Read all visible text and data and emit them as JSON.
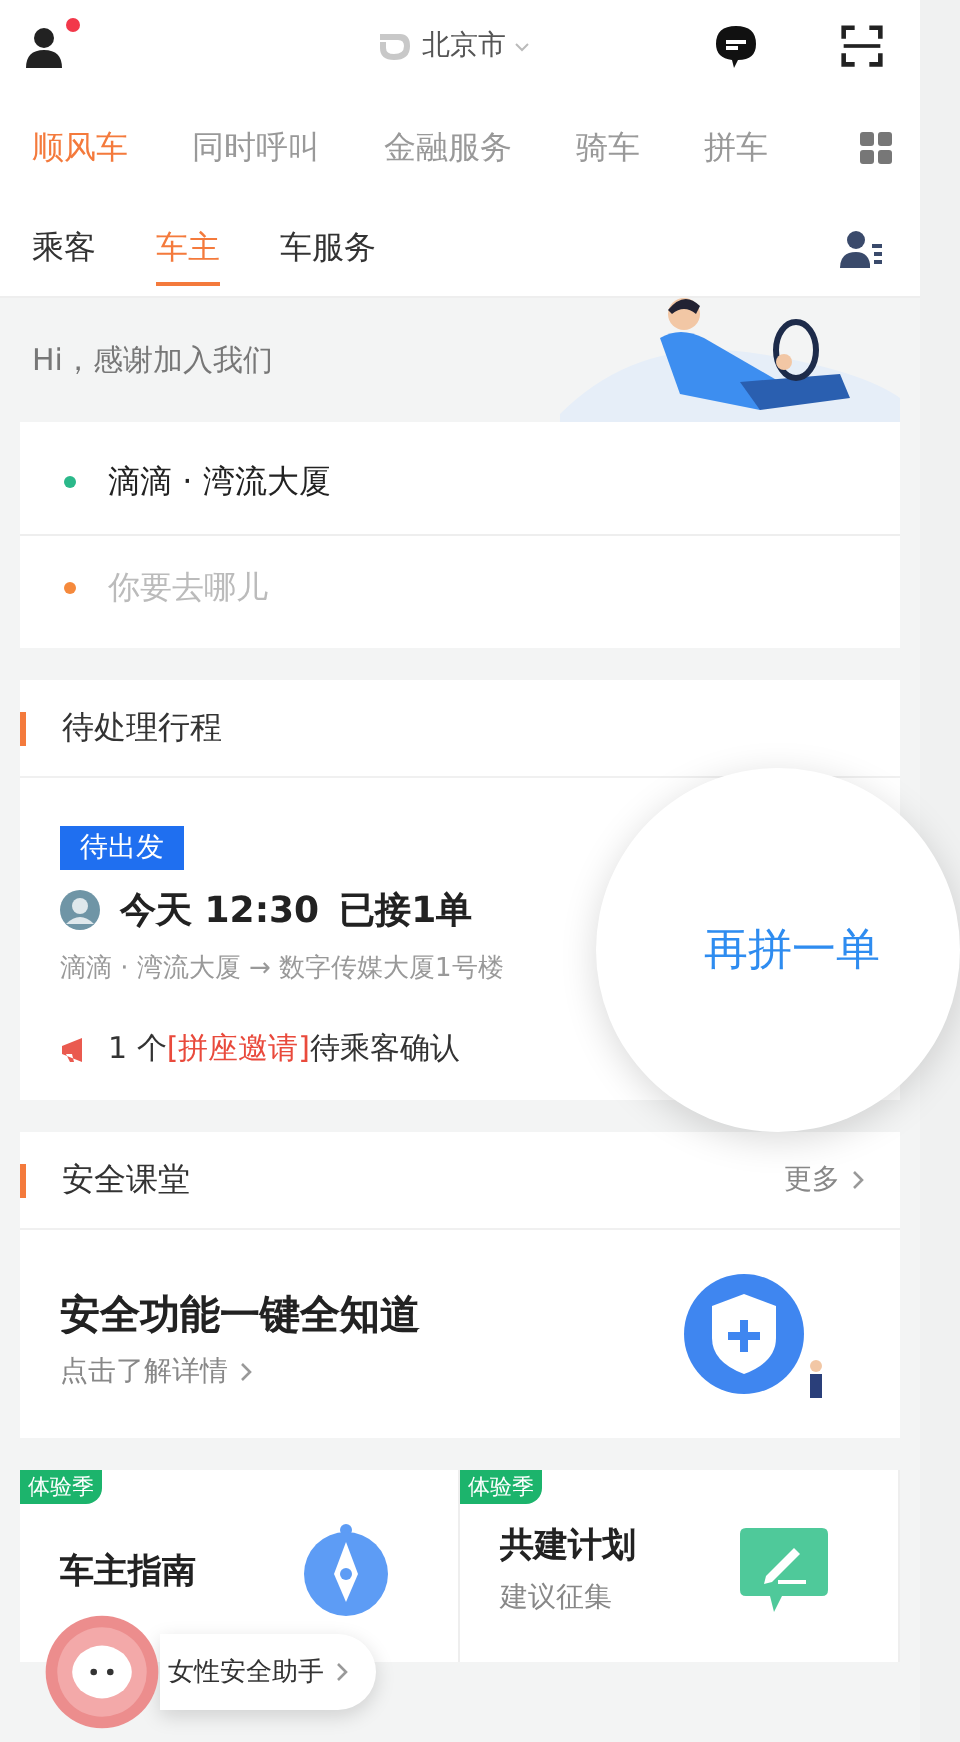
{
  "top_bar": {
    "city": "北京市",
    "has_notification": true
  },
  "services": [
    {
      "label": "顺风车",
      "selected": true
    },
    {
      "label": "同时呼叫",
      "selected": false
    },
    {
      "label": "金融服务",
      "selected": false
    },
    {
      "label": "骑车",
      "selected": false
    },
    {
      "label": "拼车",
      "selected": false
    }
  ],
  "roles": [
    {
      "label": "乘客",
      "selected": false
    },
    {
      "label": "车主",
      "selected": true
    },
    {
      "label": "车服务",
      "selected": false
    }
  ],
  "greeting": "Hi，感谢加入我们",
  "locations": [
    {
      "kind": "from",
      "text": "滴滴 · 湾流大厦",
      "color": "#2bb88a"
    },
    {
      "kind": "to",
      "placeholder": "你要去哪儿",
      "color": "#f5893c"
    }
  ],
  "pending": {
    "title": "待处理行程",
    "status": "待出发",
    "time": "今天 12:30",
    "count": "已接1单",
    "route": "滴滴 · 湾流大厦 → 数字传媒大厦1号楼",
    "notice": {
      "prefix": "1 个",
      "highlight": "[拼座邀请]",
      "suffix": "待乘客确认"
    },
    "action": "再拼一单"
  },
  "safety": {
    "title": "安全课堂",
    "more": "更多",
    "headline": "安全功能一键全知道",
    "link": "点击了解详情"
  },
  "promos": [
    {
      "badge": "体验季",
      "title": "车主指南",
      "kind": "compass"
    },
    {
      "badge": "体验季",
      "title": "共建计划",
      "subtitle": "建议征集",
      "kind": "edit"
    }
  ],
  "assistant": {
    "label": "女性安全助手"
  }
}
